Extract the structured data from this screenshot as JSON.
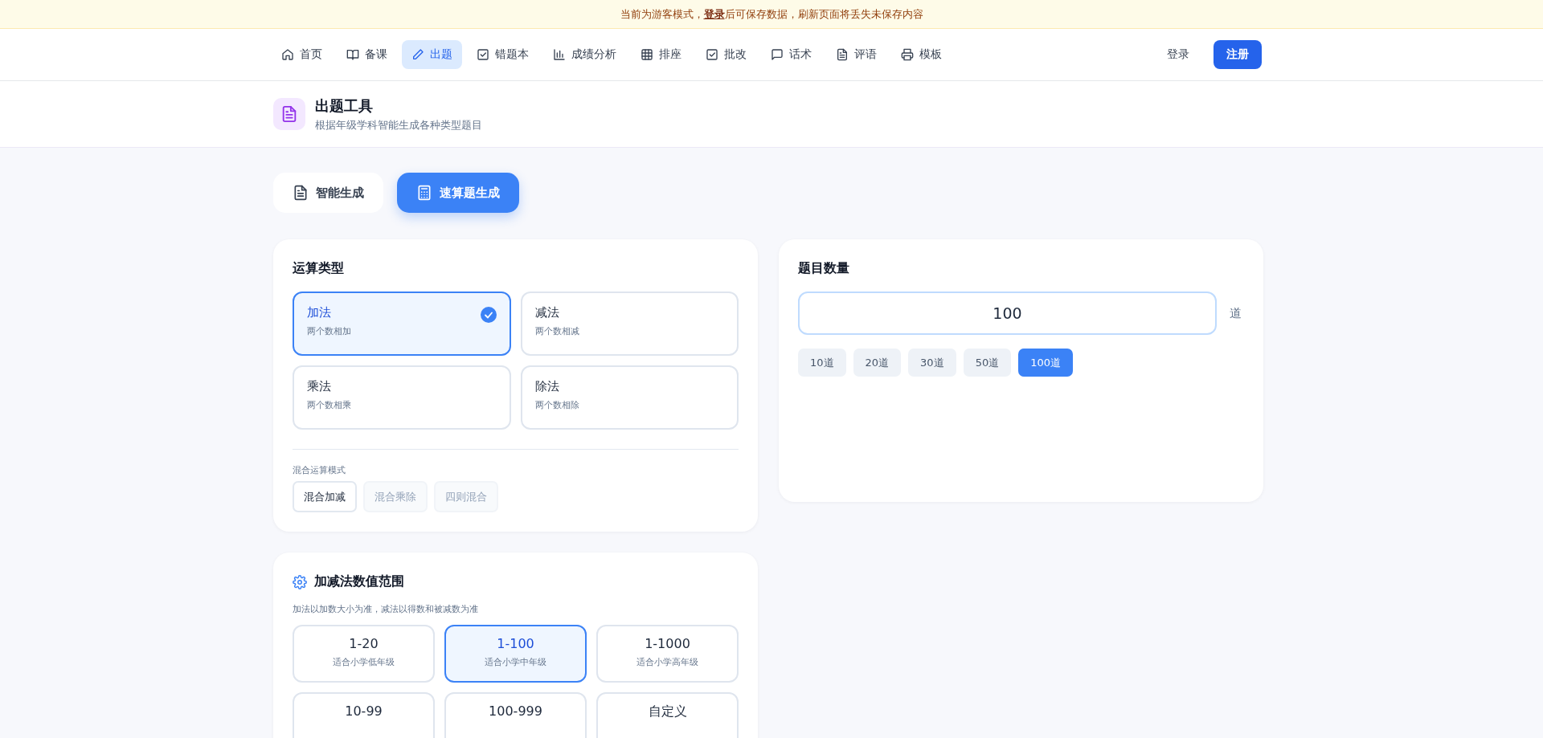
{
  "banner": {
    "text": "当前为游客模式，",
    "link": "登录",
    "after": "后可保存数据，刷新页面将丢失未保存内容"
  },
  "nav": {
    "items": [
      {
        "label": "首页",
        "selected": false
      },
      {
        "label": "备课",
        "selected": false
      },
      {
        "label": "出题",
        "selected": true
      },
      {
        "label": "错题本",
        "selected": false
      },
      {
        "label": "成绩分析",
        "selected": false
      },
      {
        "label": "排座",
        "selected": false
      },
      {
        "label": "批改",
        "selected": false
      },
      {
        "label": "话术",
        "selected": false
      },
      {
        "label": "评语",
        "selected": false
      },
      {
        "label": "模板",
        "selected": false
      }
    ],
    "login": "登录",
    "register": "注册"
  },
  "header": {
    "title": "出题工具",
    "subtitle": "根据年级学科智能生成各种类型题目"
  },
  "tabs": [
    {
      "label": "智能生成",
      "selected": false
    },
    {
      "label": "速算题生成",
      "selected": true
    }
  ],
  "operation": {
    "title": "运算类型",
    "options": [
      {
        "name": "加法",
        "desc": "两个数相加",
        "selected": true
      },
      {
        "name": "减法",
        "desc": "两个数相减",
        "selected": false
      },
      {
        "name": "乘法",
        "desc": "两个数相乘",
        "selected": false
      },
      {
        "name": "除法",
        "desc": "两个数相除",
        "selected": false
      }
    ],
    "mixed_label": "混合运算模式",
    "mixed": [
      {
        "label": "混合加减",
        "selected": true
      },
      {
        "label": "混合乘除",
        "selected": false
      },
      {
        "label": "四则混合",
        "selected": false
      }
    ]
  },
  "count": {
    "title": "题目数量",
    "value": "100",
    "unit": "道",
    "presets": [
      {
        "label": "10道",
        "selected": false
      },
      {
        "label": "20道",
        "selected": false
      },
      {
        "label": "30道",
        "selected": false
      },
      {
        "label": "50道",
        "selected": false
      },
      {
        "label": "100道",
        "selected": true
      }
    ]
  },
  "range": {
    "title": "加减法数值范围",
    "hint": "加法以加数大小为准，减法以得数和被减数为准",
    "options": [
      {
        "value": "1-20",
        "desc": "适合小学低年级",
        "selected": false
      },
      {
        "value": "1-100",
        "desc": "适合小学中年级",
        "selected": true
      },
      {
        "value": "1-1000",
        "desc": "适合小学高年级",
        "selected": false
      },
      {
        "value": "10-99",
        "selected": false
      },
      {
        "value": "100-999",
        "selected": false
      },
      {
        "value": "自定义",
        "selected": false
      }
    ]
  }
}
